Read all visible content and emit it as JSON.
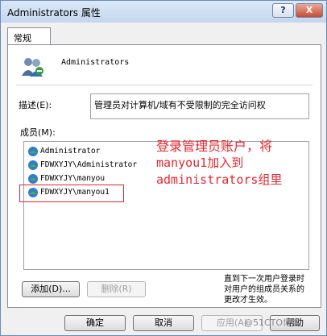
{
  "window": {
    "title": "Administrators 属性",
    "help_label": "?",
    "close_label": "X"
  },
  "tabs": [
    {
      "label": "常规"
    }
  ],
  "group": {
    "name": "Administrators"
  },
  "description": {
    "label": "描述(E):",
    "value": "管理员对计算机/域有不受限制的完全访问权"
  },
  "members": {
    "label": "成员(M):",
    "items": [
      {
        "name": "Administrator"
      },
      {
        "name": "FDWXYJY\\Administrator"
      },
      {
        "name": "FDWXYJY\\manyou"
      },
      {
        "name": "FDWXYJY\\manyou1"
      }
    ]
  },
  "annotation": {
    "line1": "登录管理员账户，将",
    "line2": "manyou1加入到",
    "line3": "administrators组里",
    "color": "#e8262e"
  },
  "buttons": {
    "add": "添加(D)...",
    "remove": "删除(R)",
    "ok": "确定",
    "cancel": "取消",
    "apply": "应用(A)",
    "help": "帮助"
  },
  "note": "直到下一次用户登录时对用户的组成员关系的更改才生效。",
  "watermark": "@51CTO博客"
}
